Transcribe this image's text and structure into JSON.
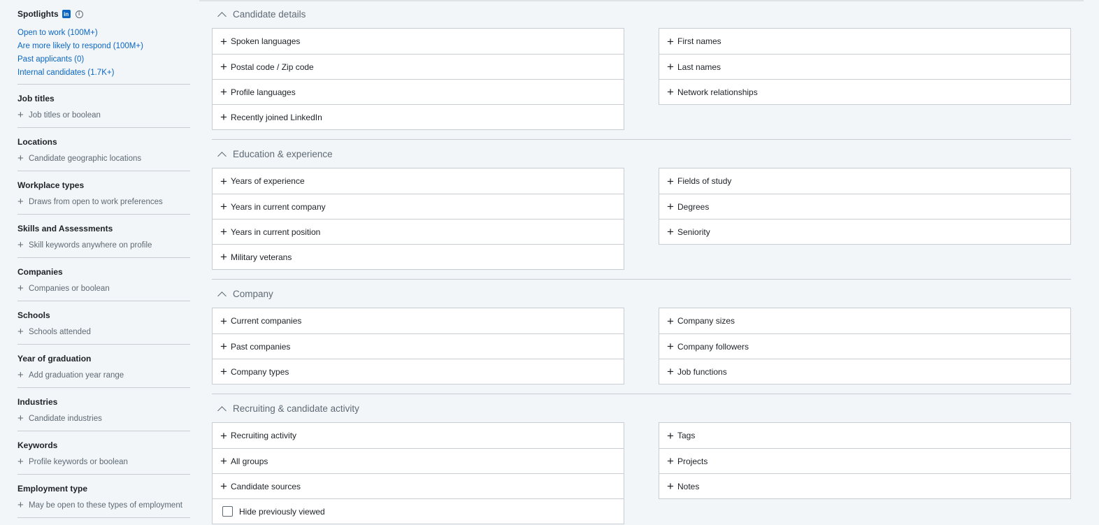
{
  "sidebar": {
    "spotlights": {
      "title": "Spotlights",
      "badge": "in",
      "info": "i",
      "links": [
        "Open to work (100M+)",
        "Are more likely to respond (100M+)",
        "Past applicants (0)",
        "Internal candidates (1.7K+)"
      ]
    },
    "filters": [
      {
        "title": "Job titles",
        "placeholder": "Job titles or boolean"
      },
      {
        "title": "Locations",
        "placeholder": "Candidate geographic locations"
      },
      {
        "title": "Workplace types",
        "placeholder": "Draws from open to work preferences"
      },
      {
        "title": "Skills and Assessments",
        "placeholder": "Skill keywords anywhere on profile"
      },
      {
        "title": "Companies",
        "placeholder": "Companies or boolean"
      },
      {
        "title": "Schools",
        "placeholder": "Schools attended"
      },
      {
        "title": "Year of graduation",
        "placeholder": "Add graduation year range"
      },
      {
        "title": "Industries",
        "placeholder": "Candidate industries"
      },
      {
        "title": "Keywords",
        "placeholder": "Profile keywords or boolean"
      },
      {
        "title": "Employment type",
        "placeholder": "May be open to these types of employment"
      }
    ]
  },
  "sections": [
    {
      "title": "Candidate details",
      "left": [
        "Spoken languages",
        "Postal code / Zip code",
        "Profile languages",
        "Recently joined LinkedIn"
      ],
      "right": [
        "First names",
        "Last names",
        "Network relationships"
      ]
    },
    {
      "title": "Education & experience",
      "left": [
        "Years of experience",
        "Years in current company",
        "Years in current position",
        "Military veterans"
      ],
      "right": [
        "Fields of study",
        "Degrees",
        "Seniority"
      ]
    },
    {
      "title": "Company",
      "left": [
        "Current companies",
        "Past companies",
        "Company types"
      ],
      "right": [
        "Company sizes",
        "Company followers",
        "Job functions"
      ]
    },
    {
      "title": "Recruiting & candidate activity",
      "left": [
        "Recruiting activity",
        "All groups",
        "Candidate sources"
      ],
      "right": [
        "Tags",
        "Projects",
        "Notes"
      ],
      "checkbox_label": "Hide previously viewed"
    }
  ]
}
